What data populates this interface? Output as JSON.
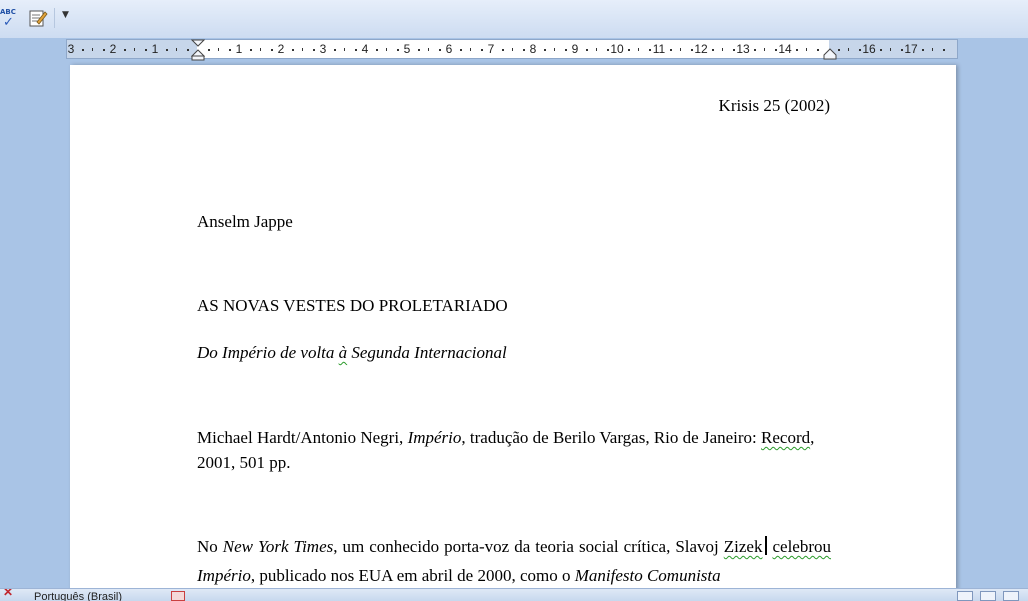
{
  "toolbar": {
    "spelling_icon_text": "ABC",
    "icons": [
      "spelling-check-icon",
      "edit-document-icon",
      "customize-toolbar-icon"
    ]
  },
  "ruler": {
    "labels": [
      "3",
      "2",
      "1",
      "1",
      "2",
      "3",
      "4",
      "5",
      "6",
      "7",
      "8",
      "9",
      "10",
      "11",
      "12",
      "13",
      "14",
      "16",
      "17"
    ]
  },
  "document": {
    "header_right": "Krisis 25 (2002)",
    "author": "Anselm Jappe",
    "title": "AS NOVAS VESTES DO PROLETARIADO",
    "subtitle_part1": "Do Império de volta ",
    "subtitle_flagged": "à",
    "subtitle_part2": " Segunda Internacional",
    "ref_part1": "Michael Hardt/Antonio Negri, ",
    "ref_book": "Império",
    "ref_part2": ", tradução de Berilo Vargas, Rio de Janeiro: ",
    "ref_publisher": "Record",
    "ref_part3": ", 2001, 501 pp.",
    "body_part1": "No ",
    "body_nyt": "New York Times",
    "body_part2": ", um conhecido porta-voz da teoria social crítica, Slavoj ",
    "body_zizek": "Zizek",
    "body_celebrou": "celebrou",
    "body_space": " ",
    "body_imperio": "Império",
    "body_part3": ", publicado nos EUA em abril de 2000, como o ",
    "body_manifesto": "Manifesto Comunista"
  },
  "status_bar": {
    "language": "Português (Brasil)"
  }
}
